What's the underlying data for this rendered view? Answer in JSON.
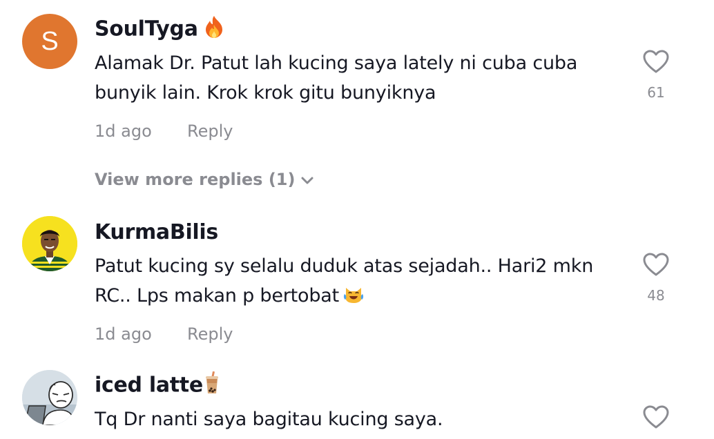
{
  "comments": [
    {
      "username": "SoulTyga",
      "username_emoji": "fire-icon",
      "avatar_letter": "S",
      "avatar_color": "#e0762f",
      "text": "Alamak Dr. Patut lah kucing saya lately ni cuba cuba bunyik lain. Krok krok gitu bunyiknya",
      "time": "1d ago",
      "reply_label": "Reply",
      "likes": "61"
    },
    {
      "username": "KurmaBilis",
      "avatar_bg": "#f6e11f",
      "text": "Patut kucing sy selalu duduk atas sejadah.. Hari2 mkn RC.. Lps makan p bertobat",
      "text_emoji": "crying-laughing-cat-icon",
      "time": "1d ago",
      "reply_label": "Reply",
      "likes": "48"
    },
    {
      "username": "iced latte",
      "username_emoji": "bubble-tea-icon",
      "avatar_bg": "#d6dfe6",
      "text": "Tq Dr nanti saya bagitau kucing saya."
    }
  ],
  "view_more": {
    "label": "View more replies (1)"
  },
  "colors": {
    "primary_text": "#161823",
    "secondary_text": "#8a8b91",
    "background": "#ffffff"
  }
}
